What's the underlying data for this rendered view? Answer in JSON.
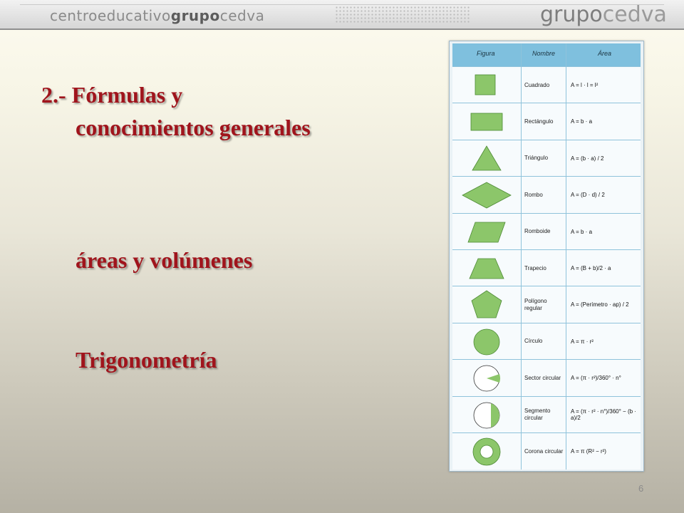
{
  "header": {
    "brand_left_a": "centro",
    "brand_left_b": "educativo",
    "brand_left_c": "grupo",
    "brand_left_d": "cedva",
    "brand_right_a": "grupo",
    "brand_right_b": "cedva"
  },
  "content": {
    "title_line1": "2.- Fórmulas y",
    "title_line2": "conocimientos generales",
    "topic_areas": "áreas y volúmenes",
    "topic_trig": "Trigonometría"
  },
  "page_number": "6",
  "formula_table": {
    "headers": [
      "Figura",
      "Nombre",
      "Área"
    ],
    "rows": [
      {
        "name": "Cuadrado",
        "formula": "A = l · l = l²"
      },
      {
        "name": "Rectángulo",
        "formula": "A = b · a"
      },
      {
        "name": "Triángulo",
        "formula": "A = (b · a) / 2"
      },
      {
        "name": "Rombo",
        "formula": "A = (D · d) / 2"
      },
      {
        "name": "Romboide",
        "formula": "A = b · a"
      },
      {
        "name": "Trapecio",
        "formula": "A = (B + b)/2 · a"
      },
      {
        "name": "Polígono regular",
        "formula": "A = (Perímetro · ap) / 2"
      },
      {
        "name": "Círculo",
        "formula": "A = π · r²"
      },
      {
        "name": "Sector circular",
        "formula": "A = (π · r²)/360° · n°"
      },
      {
        "name": "Segmento circular",
        "formula": "A = (π · r² · n°)/360° − (b · a)/2"
      },
      {
        "name": "Corona circular",
        "formula": "A = π (R² − r²)"
      }
    ],
    "shape_color": "#8cc66a"
  }
}
